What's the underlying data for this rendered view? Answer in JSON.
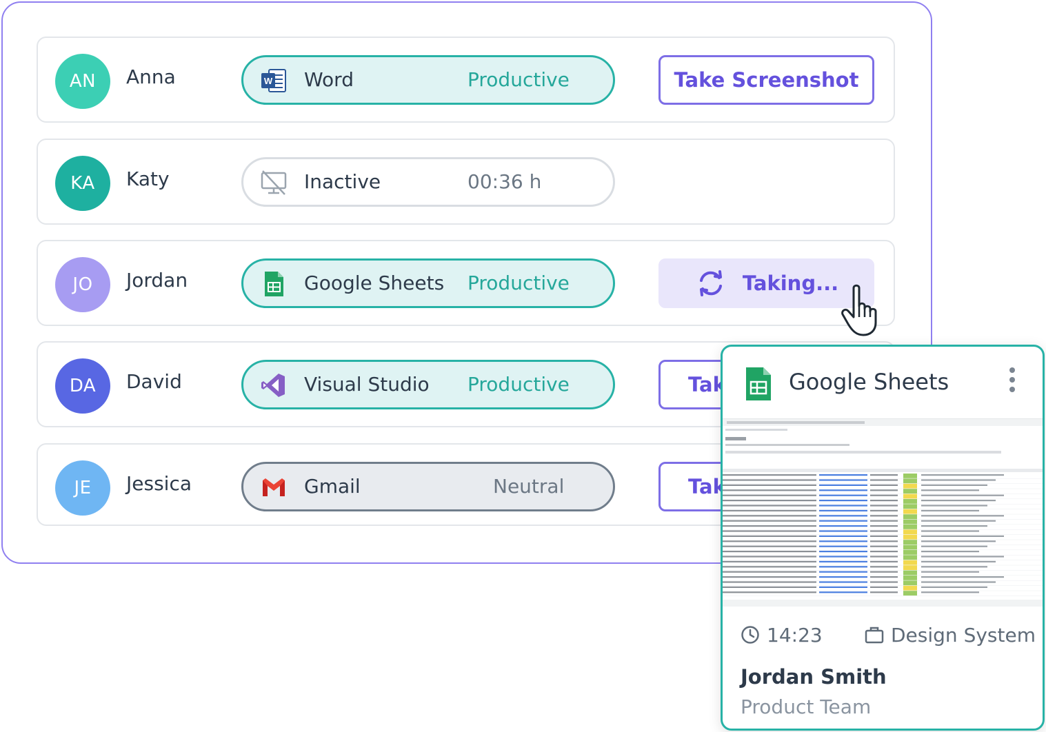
{
  "colors": {
    "accent": "#6451dd",
    "productive": "#25a79a",
    "card_border": "#27b2a6"
  },
  "rows": [
    {
      "initials": "AN",
      "name": "Anna",
      "avatar_color": "#3ccfb4",
      "app": "Word",
      "app_icon": "word-icon",
      "status": "Productive",
      "action": "Take Screenshot"
    },
    {
      "initials": "KA",
      "name": "Katy",
      "avatar_color": "#1eb0a0",
      "app": "Inactive",
      "app_icon": "monitor-off-icon",
      "status": "00:36 h",
      "action": ""
    },
    {
      "initials": "JO",
      "name": "Jordan",
      "avatar_color": "#a79cf2",
      "app": "Google Sheets",
      "app_icon": "google-sheets-icon",
      "status": "Productive",
      "action": "Taking..."
    },
    {
      "initials": "DA",
      "name": "David",
      "avatar_color": "#5867e3",
      "app": "Visual Studio",
      "app_icon": "visual-studio-icon",
      "status": "Productive",
      "action": "Tak"
    },
    {
      "initials": "JE",
      "name": "Jessica",
      "avatar_color": "#6fb6f3",
      "app": "Gmail",
      "app_icon": "gmail-icon",
      "status": "Neutral",
      "action": "Tak"
    }
  ],
  "card": {
    "app": "Google Sheets",
    "app_icon": "google-sheets-icon",
    "time": "14:23",
    "project": "Design System",
    "user": "Jordan Smith",
    "team": "Product Team"
  }
}
